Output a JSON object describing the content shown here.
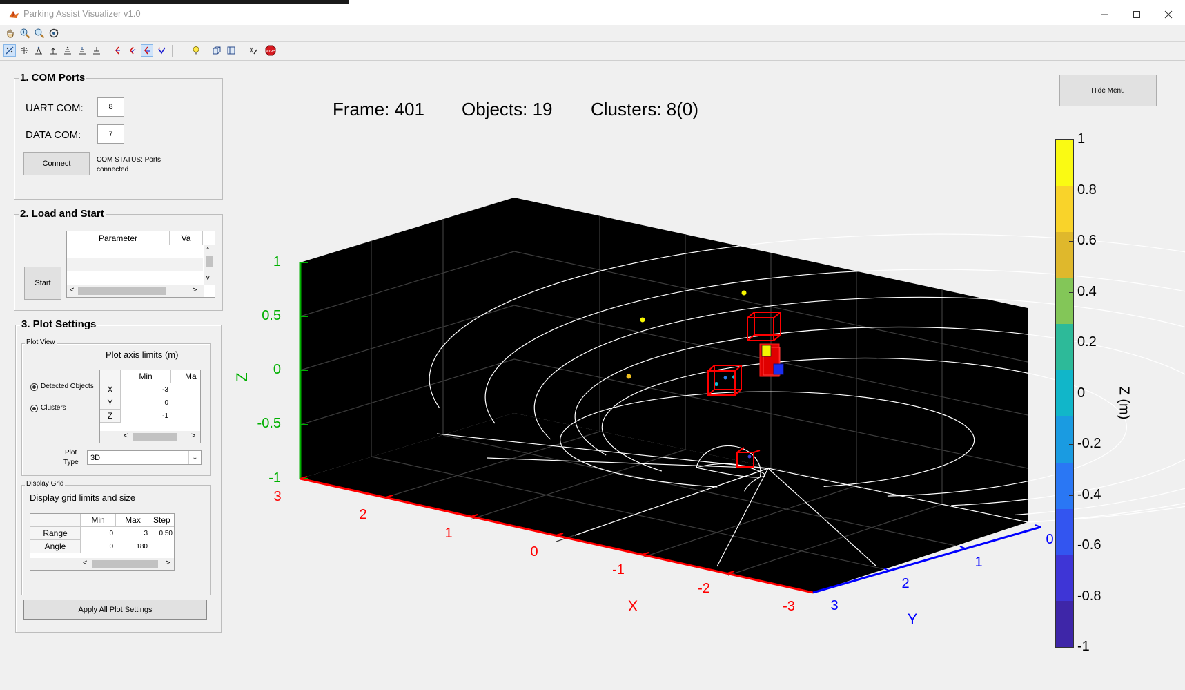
{
  "window": {
    "title": "Parking Assist Visualizer v1.0",
    "controls": [
      "minimize",
      "maximize",
      "close"
    ]
  },
  "toolbar1": {
    "icons": [
      "hand-icon",
      "zoom-in-icon",
      "zoom-out-icon",
      "rotate-icon"
    ]
  },
  "toolbar2": {
    "icons": [
      "tool-1-icon",
      "tool-2-icon",
      "tool-3-icon",
      "tool-4-icon",
      "tool-5-icon",
      "tool-6-icon",
      "tool-7-icon",
      "tool-8-icon",
      "tool-9-icon",
      "tool-10-icon",
      "tool-11-icon",
      "bulb-icon",
      "cube-3d-icon",
      "cube-2d-icon",
      "clear-icon",
      "stop-icon"
    ],
    "stop_label": "STOP"
  },
  "com_panel": {
    "title": "1. COM Ports",
    "uart_label": "UART COM:",
    "uart_value": "8",
    "data_label": "DATA COM:",
    "data_value": "7",
    "connect_label": "Connect",
    "status_line1": "COM STATUS: Ports",
    "status_line2": "connected"
  },
  "load_panel": {
    "title": "2. Load and Start",
    "start_label": "Start",
    "table_headers": [
      "Parameter",
      "Va"
    ],
    "scroll_left": "<",
    "scroll_right": ">",
    "scroll_up": "^",
    "scroll_down": "v"
  },
  "plot_panel": {
    "title": "3. Plot Settings",
    "plot_view": {
      "title": "Plot View",
      "axis_limits_label": "Plot axis limits (m)",
      "radio_detected": "Detected Objects",
      "radio_clusters": "Clusters",
      "headers": [
        "Min",
        "Ma"
      ],
      "rows": [
        {
          "label": "X",
          "min": "-3"
        },
        {
          "label": "Y",
          "min": "0"
        },
        {
          "label": "Z",
          "min": "-1"
        }
      ],
      "plot_type_label_1": "Plot",
      "plot_type_label_2": "Type",
      "plot_type_value": "3D"
    },
    "display_grid": {
      "title": "Display Grid",
      "subtitle": "Display grid limits and size",
      "headers": [
        "Min",
        "Max",
        "Step"
      ],
      "rows": [
        {
          "label": "Range",
          "min": "0",
          "max": "3",
          "step": "0.50"
        },
        {
          "label": "Angle",
          "min": "0",
          "max": "180",
          "step": ""
        }
      ]
    },
    "apply_label": "Apply All Plot Settings"
  },
  "hide_menu_label": "Hide Menu",
  "stats": {
    "frame": "Frame: 401",
    "objects": "Objects: 19",
    "clusters": "Clusters: 8(0)"
  },
  "plot": {
    "axis_colors": {
      "x": "#ff0000",
      "y": "#0000ff",
      "z": "#00b000"
    },
    "background": "#000000",
    "x_label": "X",
    "y_label": "Y",
    "z_label": "Z",
    "x_ticks": [
      "3",
      "2",
      "1",
      "0",
      "-1",
      "-2",
      "-3"
    ],
    "y_ticks": [
      "0",
      "1",
      "2",
      "3"
    ],
    "z_ticks": [
      "1",
      "0.5",
      "0",
      "-0.5",
      "-1"
    ]
  },
  "colorbar": {
    "label": "Z (m)",
    "ticks": [
      "1",
      "0.8",
      "0.6",
      "0.4",
      "0.2",
      "0",
      "-0.2",
      "-0.4",
      "-0.6",
      "-0.8",
      "-1"
    ],
    "colors": [
      "#fafa13",
      "#f9d32a",
      "#dfb82c",
      "#83c658",
      "#2dba99",
      "#11b6c9",
      "#1a9be1",
      "#2a77f4",
      "#3355f0",
      "#3e35d6",
      "#3e26a8"
    ]
  }
}
